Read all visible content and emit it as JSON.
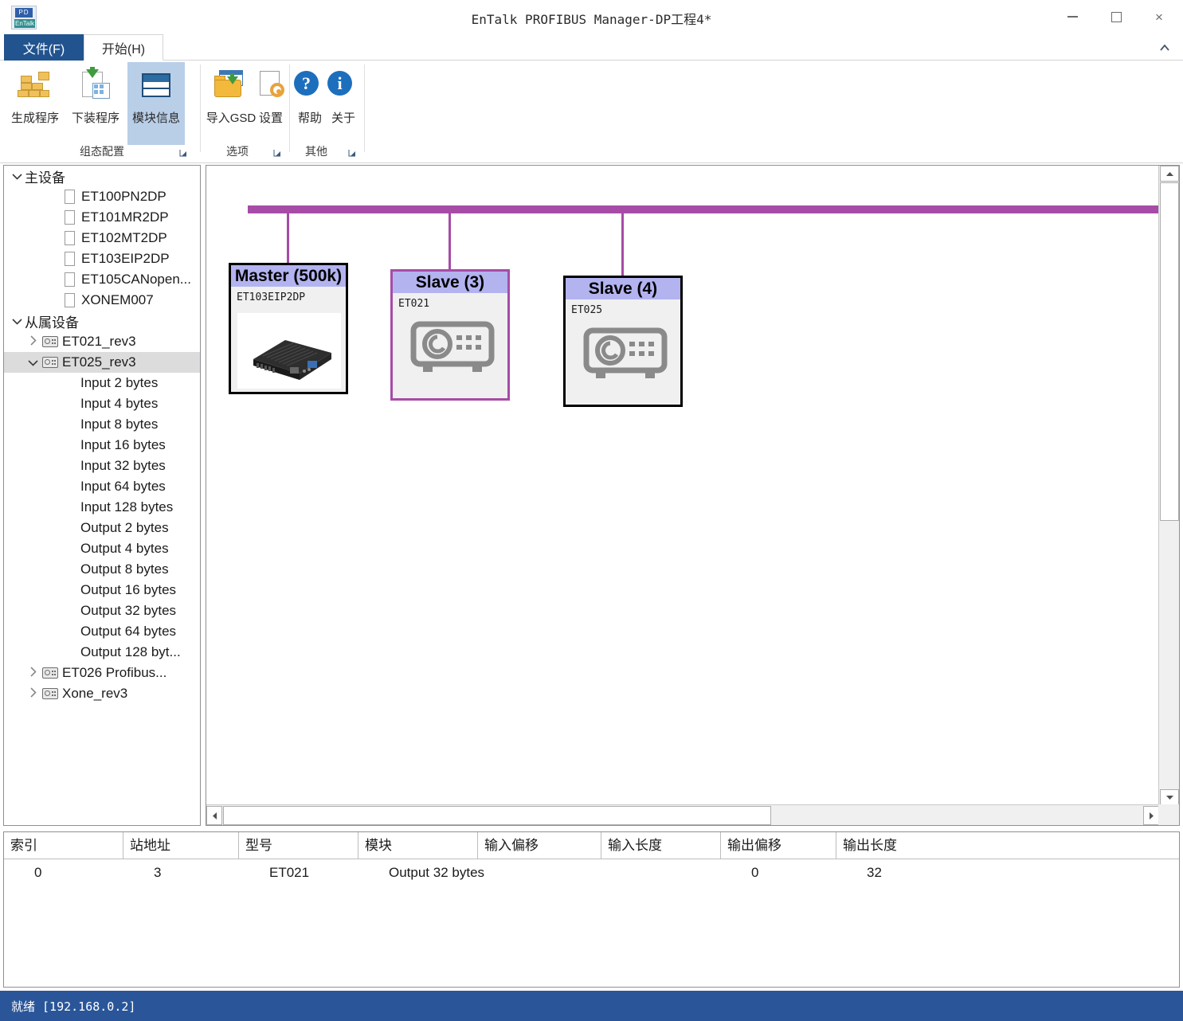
{
  "window": {
    "title": "EnTalk PROFIBUS Manager-DP工程4*",
    "minimize_label": "",
    "maximize_label": "",
    "close_label": "×"
  },
  "tabs": [
    {
      "label": "文件(F)",
      "name": "tab-file",
      "active": false
    },
    {
      "label": "开始(H)",
      "name": "tab-home",
      "active": true
    }
  ],
  "ribbon": {
    "collapse_icon": "chevron-up-icon",
    "groups": [
      {
        "label": "组态配置",
        "buttons": [
          {
            "label": "生成程序",
            "icon": "brick-build-icon",
            "active": false
          },
          {
            "label": "下装程序",
            "icon": "download-program-icon",
            "active": false
          },
          {
            "label": "模块信息",
            "icon": "module-info-icon",
            "active": true
          }
        ]
      },
      {
        "label": "选项",
        "buttons": [
          {
            "label": "导入GSD",
            "icon": "import-folder-icon",
            "active": false
          },
          {
            "label": "设置",
            "icon": "settings-gear-icon",
            "active": false
          }
        ]
      },
      {
        "label": "其他",
        "buttons": [
          {
            "label": "帮助",
            "icon": "help-question-icon",
            "active": false
          },
          {
            "label": "关于",
            "icon": "info-icon",
            "active": false
          }
        ]
      }
    ]
  },
  "tree": {
    "nodes": [
      {
        "label": "主设备",
        "depth": 0,
        "chevron": "down",
        "icon": "none",
        "selected": false
      },
      {
        "label": "ET100PN2DP",
        "depth": 2,
        "chevron": "none",
        "icon": "doc",
        "selected": false
      },
      {
        "label": "ET101MR2DP",
        "depth": 2,
        "chevron": "none",
        "icon": "doc",
        "selected": false
      },
      {
        "label": "ET102MT2DP",
        "depth": 2,
        "chevron": "none",
        "icon": "doc",
        "selected": false
      },
      {
        "label": "ET103EIP2DP",
        "depth": 2,
        "chevron": "none",
        "icon": "doc",
        "selected": false
      },
      {
        "label": "ET105CANopen...",
        "depth": 2,
        "chevron": "none",
        "icon": "doc",
        "selected": false
      },
      {
        "label": "XONEM007",
        "depth": 2,
        "chevron": "none",
        "icon": "doc",
        "selected": false
      },
      {
        "label": "从属设备",
        "depth": 0,
        "chevron": "down",
        "icon": "none",
        "selected": false
      },
      {
        "label": "ET021_rev3",
        "depth": 1,
        "chevron": "right",
        "icon": "device",
        "selected": false
      },
      {
        "label": "ET025_rev3",
        "depth": 1,
        "chevron": "down",
        "icon": "device",
        "selected": true
      },
      {
        "label": "Input 2 bytes",
        "depth": 3,
        "chevron": "none",
        "icon": "none",
        "selected": false
      },
      {
        "label": "Input 4 bytes",
        "depth": 3,
        "chevron": "none",
        "icon": "none",
        "selected": false
      },
      {
        "label": "Input 8 bytes",
        "depth": 3,
        "chevron": "none",
        "icon": "none",
        "selected": false
      },
      {
        "label": "Input 16 bytes",
        "depth": 3,
        "chevron": "none",
        "icon": "none",
        "selected": false
      },
      {
        "label": "Input 32 bytes",
        "depth": 3,
        "chevron": "none",
        "icon": "none",
        "selected": false
      },
      {
        "label": "Input 64 bytes",
        "depth": 3,
        "chevron": "none",
        "icon": "none",
        "selected": false
      },
      {
        "label": "Input 128 bytes",
        "depth": 3,
        "chevron": "none",
        "icon": "none",
        "selected": false
      },
      {
        "label": "Output 2 bytes",
        "depth": 3,
        "chevron": "none",
        "icon": "none",
        "selected": false
      },
      {
        "label": "Output 4 bytes",
        "depth": 3,
        "chevron": "none",
        "icon": "none",
        "selected": false
      },
      {
        "label": "Output 8 bytes",
        "depth": 3,
        "chevron": "none",
        "icon": "none",
        "selected": false
      },
      {
        "label": "Output 16 bytes",
        "depth": 3,
        "chevron": "none",
        "icon": "none",
        "selected": false
      },
      {
        "label": "Output 32 bytes",
        "depth": 3,
        "chevron": "none",
        "icon": "none",
        "selected": false
      },
      {
        "label": "Output 64 bytes",
        "depth": 3,
        "chevron": "none",
        "icon": "none",
        "selected": false
      },
      {
        "label": "Output 128 byt...",
        "depth": 3,
        "chevron": "none",
        "icon": "none",
        "selected": false
      },
      {
        "label": "ET026 Profibus...",
        "depth": 1,
        "chevron": "right",
        "icon": "device",
        "selected": false
      },
      {
        "label": "Xone_rev3",
        "depth": 1,
        "chevron": "right",
        "icon": "device",
        "selected": false
      }
    ]
  },
  "diagram": {
    "bus_color": "#a64ca6",
    "nodes": [
      {
        "title": "Master (500k)",
        "model": "ET103EIP2DP",
        "kind": "master",
        "selected": false,
        "border_color": "#000000"
      },
      {
        "title": "Slave (3)",
        "model": "ET021",
        "kind": "slave",
        "selected": true,
        "border_color": "#a64ca6"
      },
      {
        "title": "Slave (4)",
        "model": "ET025",
        "kind": "slave",
        "selected": false,
        "border_color": "#000000"
      }
    ]
  },
  "table": {
    "columns": [
      "索引",
      "站地址",
      "型号",
      "模块",
      "输入偏移",
      "输入长度",
      "输出偏移",
      "输出长度"
    ],
    "rows": [
      {
        "索引": "0",
        "站地址": "3",
        "型号": "ET021",
        "模块": "Output 32 bytes",
        "输入偏移": "",
        "输入长度": "",
        "输出偏移": "0",
        "输出长度": "32"
      }
    ]
  },
  "statusbar": {
    "text": "就绪 [192.168.0.2]"
  }
}
